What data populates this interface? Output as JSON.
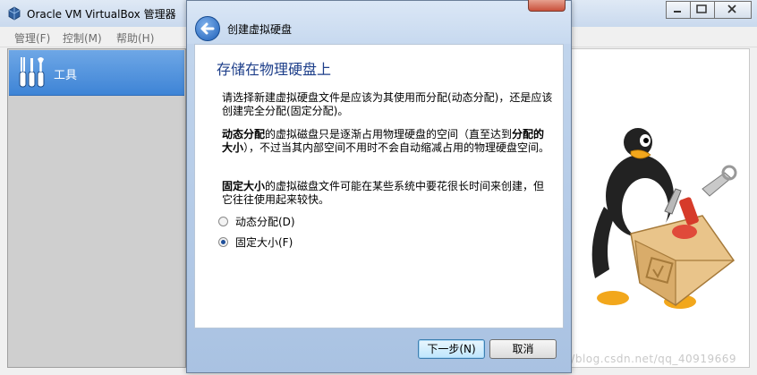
{
  "main_window": {
    "title": "Oracle VM VirtualBox 管理器",
    "menu": [
      "管理(F)",
      "控制(M)",
      "帮助(H)"
    ],
    "tools_label": "工具"
  },
  "dialog": {
    "title": "创建虚拟硬盘",
    "heading": "存储在物理硬盘上",
    "intro": "请选择新建虚拟硬盘文件是应该为其使用而分配(动态分配)，还是应该创建完全分配(固定分配)。",
    "dynamic_desc": {
      "bold1": "动态分配",
      "text1": "的虚拟磁盘只是逐渐占用物理硬盘的空间（直至达到",
      "bold2": "分配的大小",
      "text2": "），不过当其内部空间不用时不会自动缩减占用的物理硬盘空间。"
    },
    "fixed_desc": {
      "bold": "固定大小",
      "text": "的虚拟磁盘文件可能在某些系统中要花很长时间来创建，但它往往使用起来较快。"
    },
    "options": [
      {
        "label": "动态分配(D)",
        "selected": false
      },
      {
        "label": "固定大小(F)",
        "selected": true
      }
    ],
    "buttons": {
      "next": "下一步(N)",
      "cancel": "取消"
    }
  },
  "watermark": "https://blog.csdn.net/qq_40919669",
  "colors": {
    "accent": "#3e84d6",
    "heading": "#1e3f8a",
    "titlebar": "#c9d9ee"
  }
}
